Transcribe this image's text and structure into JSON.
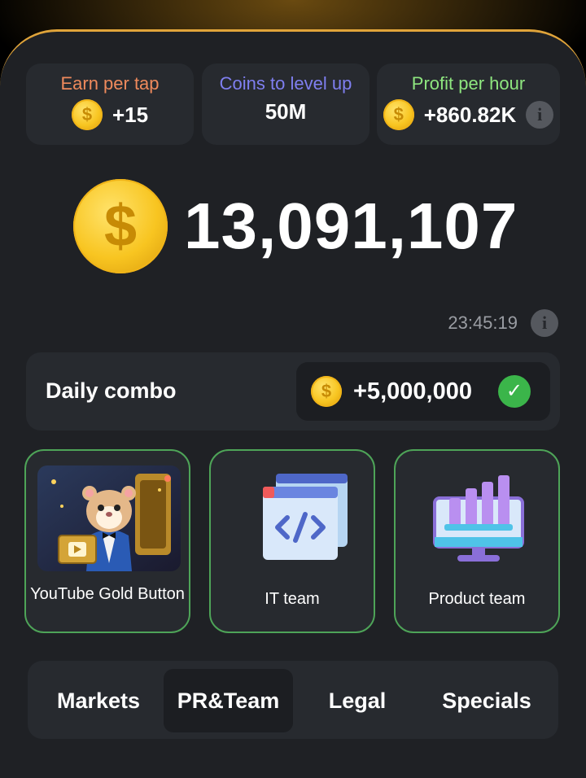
{
  "stats": {
    "earn_per_tap": {
      "label": "Earn per tap",
      "value": "+15",
      "color": "#ef8a5c"
    },
    "coins_to_level": {
      "label": "Coins to level up",
      "value": "50M",
      "color": "#7f7ff0"
    },
    "profit_per_hour": {
      "label": "Profit per hour",
      "value": "+860.82K",
      "color": "#8ee67f"
    }
  },
  "balance": "13,091,107",
  "coin_symbol": "$",
  "info_symbol": "i",
  "timer": "23:45:19",
  "daily_combo": {
    "title": "Daily combo",
    "reward": "+5,000,000",
    "check": "✓"
  },
  "cards": [
    {
      "label": "YouTube Gold Button",
      "icon": "hamster-gold-button-image"
    },
    {
      "label": "IT team",
      "icon": "code-window-icon"
    },
    {
      "label": "Product team",
      "icon": "bar-chart-monitor-icon"
    }
  ],
  "tabs": [
    {
      "label": "Markets",
      "active": false
    },
    {
      "label": "PR&Team",
      "active": true
    },
    {
      "label": "Legal",
      "active": false
    },
    {
      "label": "Specials",
      "active": false
    }
  ],
  "colors": {
    "accent_gold": "#e0a43a",
    "check_green": "#3bb54a",
    "card_border": "#4ea458"
  }
}
